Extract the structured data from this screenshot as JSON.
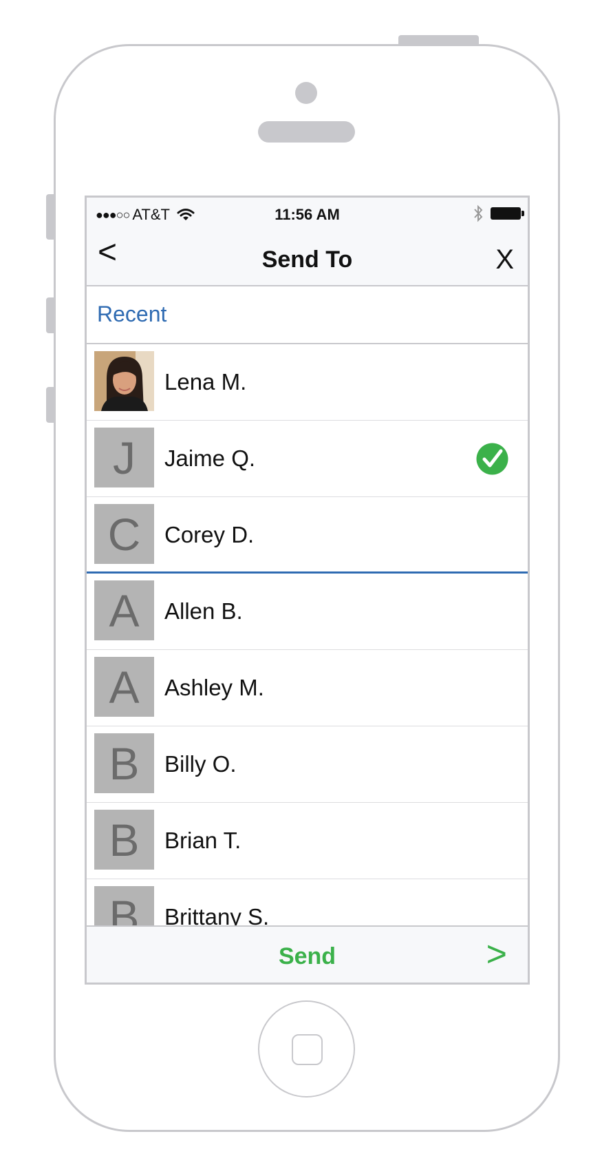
{
  "status_bar": {
    "signal": "●●●○○",
    "carrier": "AT&T",
    "time": "11:56 AM",
    "icons": [
      "wifi-icon",
      "bluetooth-icon",
      "battery-icon"
    ]
  },
  "nav": {
    "back_label": "<",
    "title": "Send To",
    "close_label": "X"
  },
  "section": {
    "label": "Recent"
  },
  "contacts": [
    {
      "initial": "",
      "name": "Lena M.",
      "photo": true,
      "selected": false
    },
    {
      "initial": "J",
      "name": "Jaime Q.",
      "photo": false,
      "selected": true
    },
    {
      "initial": "C",
      "name": "Corey D.",
      "photo": false,
      "selected": false
    },
    {
      "initial": "A",
      "name": "Allen B.",
      "photo": false,
      "selected": false
    },
    {
      "initial": "A",
      "name": "Ashley M.",
      "photo": false,
      "selected": false
    },
    {
      "initial": "B",
      "name": "Billy O.",
      "photo": false,
      "selected": false
    },
    {
      "initial": "B",
      "name": "Brian T.",
      "photo": false,
      "selected": false
    },
    {
      "initial": "B",
      "name": "Brittany S.",
      "photo": false,
      "selected": false
    }
  ],
  "bottom_bar": {
    "send_label": "Send",
    "arrow_label": ">"
  },
  "colors": {
    "accent_blue": "#2f6bb2",
    "send_green": "#3bb14a",
    "avatar_gray": "#b4b4b4",
    "frame_gray": "#c8c8cc"
  }
}
